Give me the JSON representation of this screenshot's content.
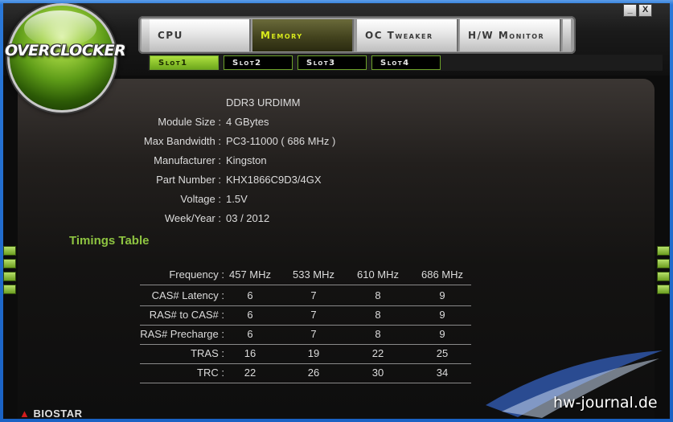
{
  "window": {
    "minimize_label": "_",
    "close_label": "X"
  },
  "brand": {
    "name": "OVERCLOCKER",
    "footer_logo": "BIOSTAR",
    "watermark": "hw-journal.de"
  },
  "tabs": [
    {
      "label": "CPU",
      "active": false
    },
    {
      "label": "Memory",
      "active": true
    },
    {
      "label": "OC Tweaker",
      "active": false
    },
    {
      "label": "H/W Monitor",
      "active": false
    }
  ],
  "slots": [
    {
      "label": "Slot1",
      "active": true
    },
    {
      "label": "Slot2",
      "active": false
    },
    {
      "label": "Slot3",
      "active": false
    },
    {
      "label": "Slot4",
      "active": false
    }
  ],
  "module": {
    "type": "DDR3 URDIMM",
    "fields": [
      {
        "label": "Module Size :",
        "value": "4 GBytes"
      },
      {
        "label": "Max Bandwidth :",
        "value": "PC3-11000 ( 686 MHz )"
      },
      {
        "label": "Manufacturer :",
        "value": "Kingston"
      },
      {
        "label": "Part Number :",
        "value": "KHX1866C9D3/4GX"
      },
      {
        "label": "Voltage :",
        "value": "1.5V"
      },
      {
        "label": "Week/Year :",
        "value": "03 / 2012"
      }
    ]
  },
  "timings": {
    "title": "Timings Table",
    "header": {
      "label": "Frequency :",
      "values": [
        "457 MHz",
        "533 MHz",
        "610 MHz",
        "686 MHz"
      ]
    },
    "rows": [
      {
        "label": "CAS# Latency :",
        "values": [
          "6",
          "7",
          "8",
          "9"
        ]
      },
      {
        "label": "RAS# to CAS# :",
        "values": [
          "6",
          "7",
          "8",
          "9"
        ]
      },
      {
        "label": "RAS# Precharge :",
        "values": [
          "6",
          "7",
          "8",
          "9"
        ]
      },
      {
        "label": "TRAS :",
        "values": [
          "16",
          "19",
          "22",
          "25"
        ]
      },
      {
        "label": "TRC :",
        "values": [
          "22",
          "26",
          "30",
          "34"
        ]
      }
    ]
  },
  "colors": {
    "accent": "#8ec441",
    "active_tab_text": "#d8ea1c",
    "titlebar": "#1d6fd8"
  }
}
